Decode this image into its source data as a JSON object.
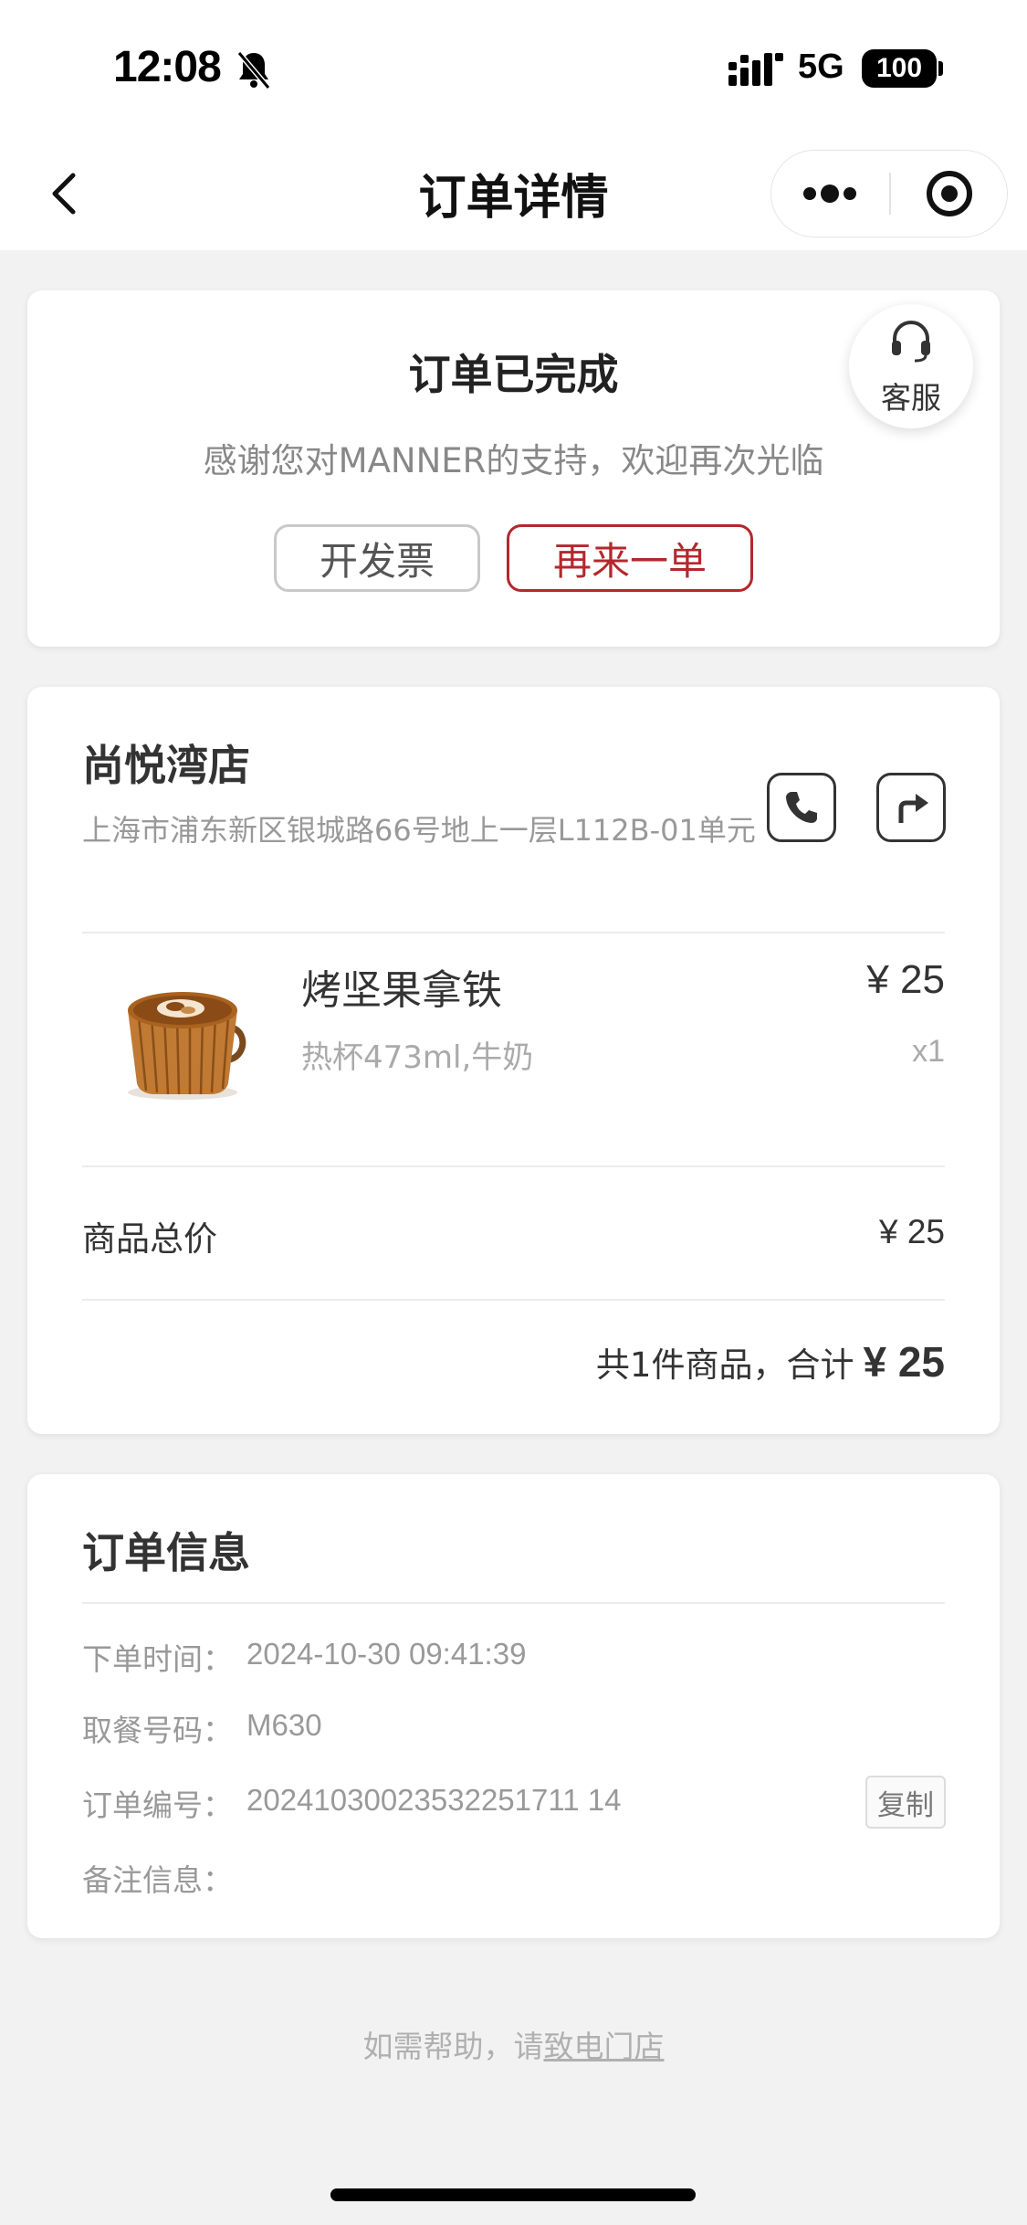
{
  "status_bar": {
    "time": "12:08",
    "network": "5G",
    "battery": "100"
  },
  "nav": {
    "title": "订单详情"
  },
  "status_card": {
    "title": "订单已完成",
    "subtitle": "感谢您对MANNER的支持，欢迎再次光临",
    "invoice_label": "开发票",
    "reorder_label": "再来一单",
    "service_label": "客服"
  },
  "store": {
    "name": "尚悦湾店",
    "address": "上海市浦东新区银城路66号地上一层L112B-01单元"
  },
  "product": {
    "name": "烤坚果拿铁",
    "spec": "热杯473ml,牛奶",
    "price": "¥ 25",
    "qty": "x1"
  },
  "totals": {
    "subtotal_label": "商品总价",
    "subtotal_value": "¥ 25",
    "summary_text": "共1件商品，合计",
    "summary_total": "¥ 25"
  },
  "order_info": {
    "title": "订单信息",
    "rows": [
      {
        "label": "下单时间：",
        "value": "2024-10-30 09:41:39"
      },
      {
        "label": "取餐号码：",
        "value": "M630"
      },
      {
        "label": "订单编号：",
        "value": "20241030023532251711 14"
      },
      {
        "label": "备注信息：",
        "value": ""
      }
    ],
    "copy_label": "复制"
  },
  "help": {
    "prefix": "如需帮助，请",
    "link": "致电门店"
  },
  "colors": {
    "accent": "#b3282d",
    "background": "#f2f2f2"
  }
}
